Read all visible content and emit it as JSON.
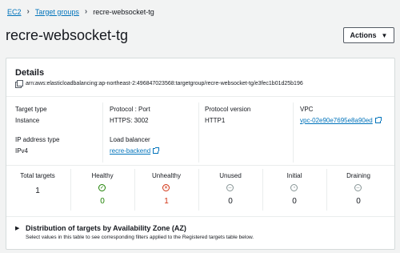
{
  "breadcrumb": {
    "items": [
      "EC2",
      "Target groups",
      "recre-websocket-tg"
    ]
  },
  "page": {
    "title": "recre-websocket-tg",
    "actions_label": "Actions"
  },
  "details": {
    "title": "Details",
    "arn": "arn:aws:elasticloadbalancing:ap-northeast-2:496847023568:targetgroup/recre-websocket-tg/e3fec1b01d25b196",
    "fields": {
      "target_type": {
        "label": "Target type",
        "value": "Instance"
      },
      "protocol_port": {
        "label": "Protocol : Port",
        "value": "HTTPS: 3002"
      },
      "protocol_version": {
        "label": "Protocol version",
        "value": "HTTP1"
      },
      "vpc": {
        "label": "VPC",
        "value": "vpc-02e90e7695e8a90ed"
      },
      "ip_address_type": {
        "label": "IP address type",
        "value": "IPv4"
      },
      "load_balancer": {
        "label": "Load balancer",
        "value": "recre-backend"
      }
    }
  },
  "stats": {
    "total": {
      "label": "Total targets",
      "value": "1"
    },
    "healthy": {
      "label": "Healthy",
      "value": "0",
      "color": "#1d8102"
    },
    "unhealthy": {
      "label": "Unhealthy",
      "value": "1",
      "color": "#d13212"
    },
    "unused": {
      "label": "Unused",
      "value": "0",
      "color": "#879596"
    },
    "initial": {
      "label": "Initial",
      "value": "0",
      "color": "#879596"
    },
    "draining": {
      "label": "Draining",
      "value": "0",
      "color": "#879596"
    }
  },
  "az": {
    "title": "Distribution of targets by Availability Zone (AZ)",
    "description": "Select values in this table to see corresponding filters applied to the Registered targets table below."
  }
}
